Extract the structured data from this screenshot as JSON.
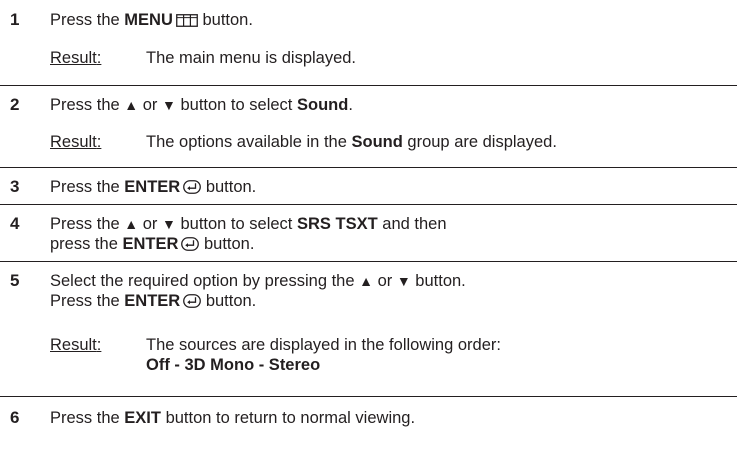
{
  "result_label": "Result",
  "colon": ":",
  "steps": [
    {
      "number": "1",
      "press_the": "Press the",
      "button_name": "MENU",
      "button_word": "button.",
      "icon": "menu-icon",
      "result": "The main menu is displayed."
    },
    {
      "number": "2",
      "press_the": "Press the",
      "up": "▲",
      "or": "or",
      "down": "▼",
      "mid": "button to select",
      "target": "Sound",
      "period": ".",
      "result_pre": "The options available in the",
      "result_bold": "Sound",
      "result_post": "group are displayed."
    },
    {
      "number": "3",
      "press_the": "Press the",
      "button_name": "ENTER",
      "button_word": "button.",
      "icon": "enter-icon"
    },
    {
      "number": "4",
      "press_the": "Press the",
      "up": "▲",
      "or": "or",
      "down": "▼",
      "mid": "button to select",
      "target": "SRS TSXT",
      "and_then": "and then",
      "press_the_2": "press the",
      "button_name": "ENTER",
      "button_word": "button.",
      "icon": "enter-icon"
    },
    {
      "number": "5",
      "line1_pre": "Select the required option by pressing the",
      "up": "▲",
      "or": "or",
      "down": "▼",
      "line1_post": "button.",
      "press_the": "Press the",
      "button_name": "ENTER",
      "button_word": "button.",
      "icon": "enter-icon",
      "result_line1": "The sources are displayed in the following order:",
      "result_line2": "Off - 3D Mono - Stereo"
    },
    {
      "number": "6",
      "press_the": "Press the",
      "button_name": "EXIT",
      "rest": "button to return to normal viewing."
    }
  ]
}
